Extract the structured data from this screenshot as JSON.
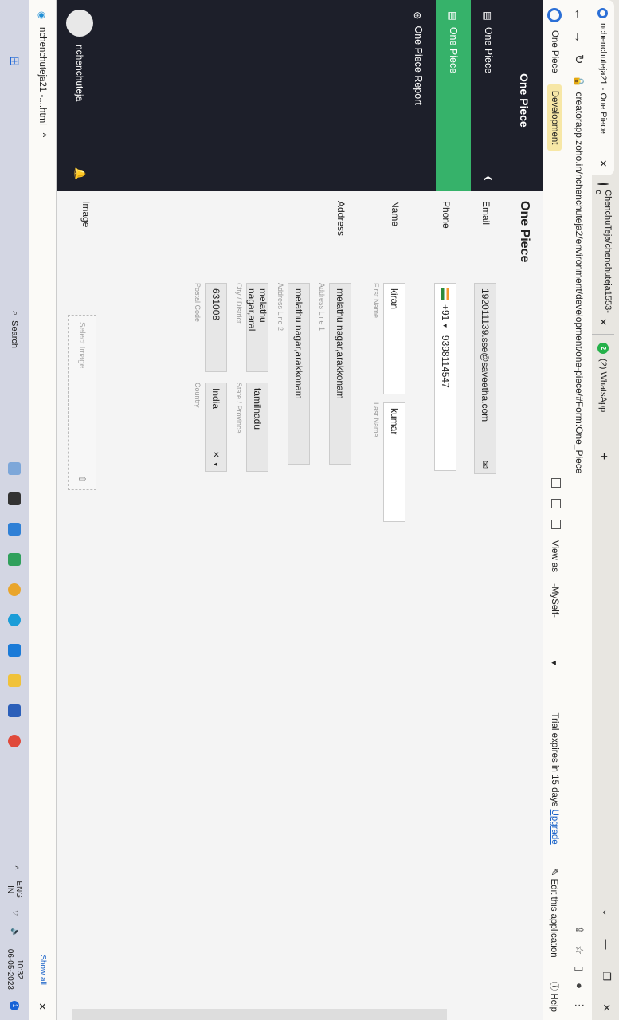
{
  "browser": {
    "tabs": [
      {
        "title": "nchenchuteja21 - One Piece"
      },
      {
        "title": "ChenchuTeja/chenchuteja1553-c"
      },
      {
        "title": "(2) WhatsApp"
      }
    ],
    "whatsapp_badge": "2",
    "url": "creatorapp.zoho.in/nchenchuteja2/environment/development/one-piece/#Form:One_Piece"
  },
  "app_header": {
    "app_name": "One Piece",
    "environment": "Development",
    "view_as_label": "View as",
    "view_as_value": "-MySelf-",
    "trial_text": "Trial expires in 15 days",
    "upgrade_label": "Upgrade",
    "edit_label": "Edit this application",
    "help_label": "Help"
  },
  "sidebar": {
    "title": "One Piece",
    "items": [
      {
        "label": "One Piece",
        "icon": "form-icon"
      },
      {
        "label": "One Piece",
        "icon": "form-icon"
      },
      {
        "label": "One Piece Report",
        "icon": "report-icon"
      }
    ],
    "user": "nchenchuteja"
  },
  "form": {
    "title": "One Piece",
    "email_label": "Email",
    "email_value": "192011139.sse@saveetha.com",
    "phone_label": "Phone",
    "phone_code": "+91",
    "phone_value": "9398114547",
    "name_label": "Name",
    "first_name": "kiran",
    "first_name_caption": "First Name",
    "last_name": "kumar",
    "last_name_caption": "Last Name",
    "address_label": "Address",
    "address_line1": "melathu nagar,arakkonam",
    "address_line1_caption": "Address Line 1",
    "address_line2": "melathu nagar,arakkonam",
    "address_line2_caption": "Address Line 2",
    "city": "melathu nagar,aral",
    "city_caption": "City / District",
    "state": "tamilnadu",
    "state_caption": "State / Province",
    "postal": "631008",
    "postal_caption": "Postal Code",
    "country": "India",
    "country_caption": "Country",
    "image_label": "Image",
    "image_placeholder": "Select Image"
  },
  "downloads": {
    "file": "nchenchuteja21 -....html",
    "show_all": "Show all"
  },
  "taskbar": {
    "search": "Search",
    "lang": "ENG",
    "region": "IN",
    "time": "10:32",
    "date": "06-05-2023",
    "notifications": "1"
  }
}
